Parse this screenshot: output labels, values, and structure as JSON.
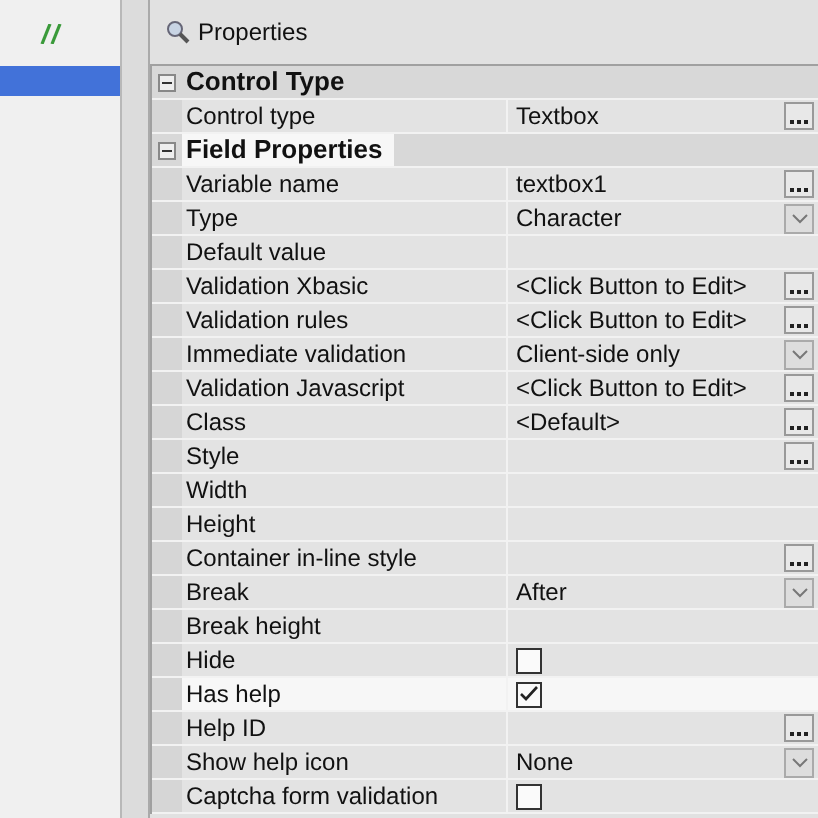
{
  "panel_title": "Properties",
  "categories": [
    {
      "title": "Control Type",
      "expanded": true,
      "highlighted": false,
      "rows": [
        {
          "name": "Control type",
          "value": "Textbox",
          "kind": "button",
          "highlighted": false
        }
      ]
    },
    {
      "title": "Field Properties",
      "expanded": true,
      "highlighted": true,
      "rows": [
        {
          "name": "Variable name",
          "value": "textbox1",
          "kind": "button",
          "highlighted": false
        },
        {
          "name": "Type",
          "value": "Character",
          "kind": "dropdown",
          "highlighted": false
        },
        {
          "name": "Default value",
          "kind": "none",
          "highlighted": false
        },
        {
          "name": "Validation Xbasic",
          "value": "<Click Button to Edit>",
          "kind": "button",
          "highlighted": false
        },
        {
          "name": "Validation rules",
          "value": "<Click Button to Edit>",
          "kind": "button",
          "highlighted": false
        },
        {
          "name": "Immediate validation",
          "value": "Client-side only",
          "kind": "dropdown",
          "highlighted": false
        },
        {
          "name": "Validation Javascript",
          "value": "<Click Button to Edit>",
          "kind": "button",
          "highlighted": false
        },
        {
          "name": "Class",
          "value": "<Default>",
          "kind": "button",
          "highlighted": false
        },
        {
          "name": "Style",
          "kind": "button",
          "highlighted": false
        },
        {
          "name": "Width",
          "kind": "none",
          "highlighted": false
        },
        {
          "name": "Height",
          "kind": "none",
          "highlighted": false
        },
        {
          "name": "Container in-line style",
          "kind": "button",
          "highlighted": false
        },
        {
          "name": "Break",
          "value": "After",
          "kind": "dropdown",
          "highlighted": false
        },
        {
          "name": "Break height",
          "kind": "none",
          "highlighted": false
        },
        {
          "name": "Hide",
          "kind": "checkbox",
          "checked": false,
          "highlighted": false
        },
        {
          "name": "Has help",
          "kind": "checkbox",
          "checked": true,
          "highlighted": true
        },
        {
          "name": "Help ID",
          "kind": "button",
          "highlighted": false
        },
        {
          "name": "Show help icon",
          "value": "None",
          "kind": "dropdown",
          "highlighted": false
        },
        {
          "name": "Captcha form validation",
          "kind": "checkbox",
          "checked": false,
          "highlighted": false
        }
      ]
    }
  ]
}
